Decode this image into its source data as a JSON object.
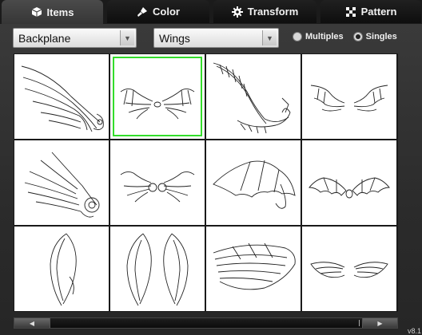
{
  "tabs": [
    {
      "label": "Items",
      "icon": "cube-icon",
      "active": true
    },
    {
      "label": "Color",
      "icon": "brush-icon",
      "active": false
    },
    {
      "label": "Transform",
      "icon": "gear-icon",
      "active": false
    },
    {
      "label": "Pattern",
      "icon": "checker-icon",
      "active": false
    }
  ],
  "controls": {
    "category_select": {
      "value": "Backplane"
    },
    "item_select": {
      "value": "Wings"
    },
    "radio": {
      "multiples_label": "Multiples",
      "singles_label": "Singles",
      "selected": "Singles"
    }
  },
  "grid": {
    "rows": 3,
    "columns": 4,
    "selected_index": 1,
    "items": [
      {
        "icon": "single-feathered-wing-icon"
      },
      {
        "icon": "pair-bone-wings-icon"
      },
      {
        "icon": "curved-mechanical-wing-icon"
      },
      {
        "icon": "pair-swept-wings-icon"
      },
      {
        "icon": "single-mechanical-wing-icon"
      },
      {
        "icon": "pair-mechanical-wings-icon"
      },
      {
        "icon": "single-bat-wing-icon"
      },
      {
        "icon": "pair-bat-wings-icon"
      },
      {
        "icon": "single-curved-wing-icon"
      },
      {
        "icon": "pair-curved-wings-icon"
      },
      {
        "icon": "single-angel-wing-icon"
      },
      {
        "icon": "pair-angel-wings-icon"
      }
    ]
  },
  "footer": {
    "version": "v8.1"
  },
  "colors": {
    "selection": "#33dd2a",
    "tab_active": "#404040"
  }
}
